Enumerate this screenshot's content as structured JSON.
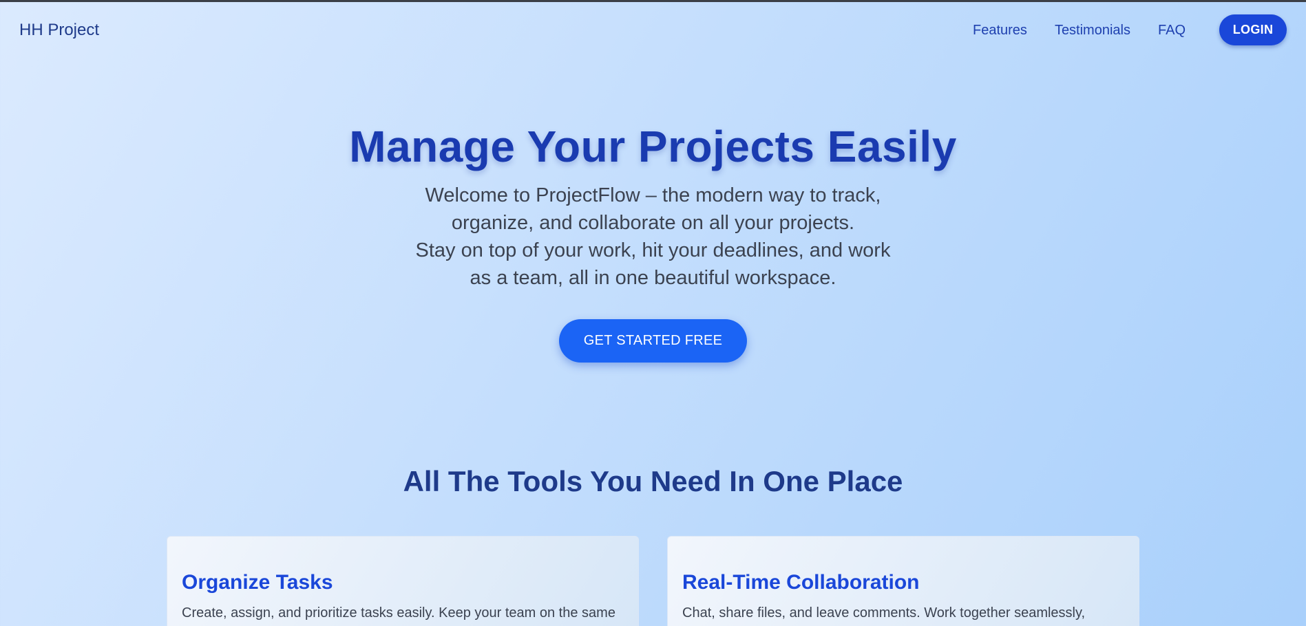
{
  "nav": {
    "brand": "HH Project",
    "links": [
      "Features",
      "Testimonials",
      "FAQ"
    ],
    "login_label": "LOGIN"
  },
  "hero": {
    "title": "Manage Your Projects Easily",
    "subtitle_lines": [
      "Welcome to ProjectFlow – the modern way to track,",
      "organize, and collaborate on all your projects.",
      "Stay on top of your work, hit your deadlines, and work",
      "as a team, all in one beautiful workspace."
    ],
    "cta_label": "GET STARTED FREE"
  },
  "features": {
    "title": "All The Tools You Need In One Place",
    "cards": [
      {
        "title": "Organize Tasks",
        "text": "Create, assign, and prioritize tasks easily. Keep your team on the same"
      },
      {
        "title": "Real-Time Collaboration",
        "text": "Chat, share files, and leave comments. Work together seamlessly,"
      }
    ]
  },
  "colors": {
    "primary": "#1a47d9",
    "cta": "#1b64f5",
    "heading": "#1e3a8a",
    "text": "#3b4250"
  }
}
